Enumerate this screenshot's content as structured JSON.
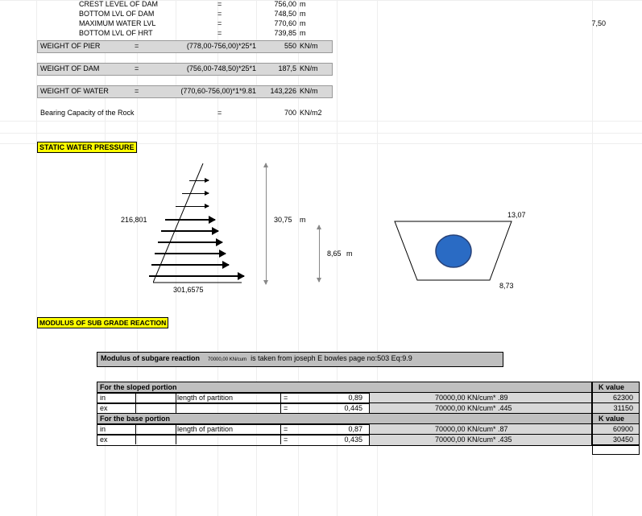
{
  "top_params": [
    {
      "label": "CREST LEVEL OF DAM",
      "eq": "=",
      "val": "756,00",
      "unit": "m"
    },
    {
      "label": "BOTTOM LVL OF DAM",
      "eq": "=",
      "val": "748,50",
      "unit": "m"
    },
    {
      "label": "MAXIMUM WATER LVL",
      "eq": "=",
      "val": "770,60",
      "unit": "m",
      "extra": "7,50"
    },
    {
      "label": "BOTTOM LVL OF HRT",
      "eq": "=",
      "val": "739,85",
      "unit": "m"
    }
  ],
  "weight_rows": [
    {
      "name": "WEIGHT OF PIER",
      "eq": "=",
      "expr": "(778,00-756,00)*25*1",
      "val": "550",
      "unit": "KN/m"
    },
    {
      "name": "WEIGHT OF DAM",
      "eq": "=",
      "expr": "(756,00-748,50)*25*1",
      "val": "187,5",
      "unit": "KN/m"
    },
    {
      "name": "WEIGHT OF WATER",
      "eq": "=",
      "expr": "(770,60-756,00)*1*9.81",
      "val": "143,226",
      "unit": "KN/m"
    }
  ],
  "bearing": {
    "label": "Bearing Capacity of the Rock",
    "eq": "=",
    "val": "700",
    "unit": "KN/m2"
  },
  "section1": "STATIC WATER PRESSURE",
  "press_left": "216,801",
  "press_bottom": "301,6575",
  "dim1_val": "30,75",
  "dim1_unit": "m",
  "dim2_val": "8,65",
  "dim2_unit": "m",
  "trap_top": "13,07",
  "trap_bottom": "8,73",
  "section2": "MODULUS OF SUB GRADE REACTION",
  "note": {
    "t1": "Modulus of subgare reaction",
    "t2": "70000,00 KN/cum",
    "t3": "is taken from joseph E bowles  page no:503 Eq:9.9"
  },
  "tbl": {
    "h1": "For the sloped portion",
    "k": "K value",
    "r1": {
      "c1": "in",
      "c2": "length of partition",
      "eq": "=",
      "v": "0,89",
      "f": "70000,00 KN/cum* .89",
      "k": "62300"
    },
    "r2": {
      "c1": "ex",
      "c2": "",
      "eq": "=",
      "v": "0,445",
      "f": "70000,00 KN/cum* .445",
      "k": "31150"
    },
    "h2": "For the base portion",
    "r3": {
      "c1": "in",
      "c2": "length of partition",
      "eq": "=",
      "v": "0,87",
      "f": "70000,00 KN/cum* .87",
      "k": "60900"
    },
    "r4": {
      "c1": "ex",
      "c2": "",
      "eq": "=",
      "v": "0,435",
      "f": "70000,00 KN/cum* .435",
      "k": "30450"
    }
  }
}
